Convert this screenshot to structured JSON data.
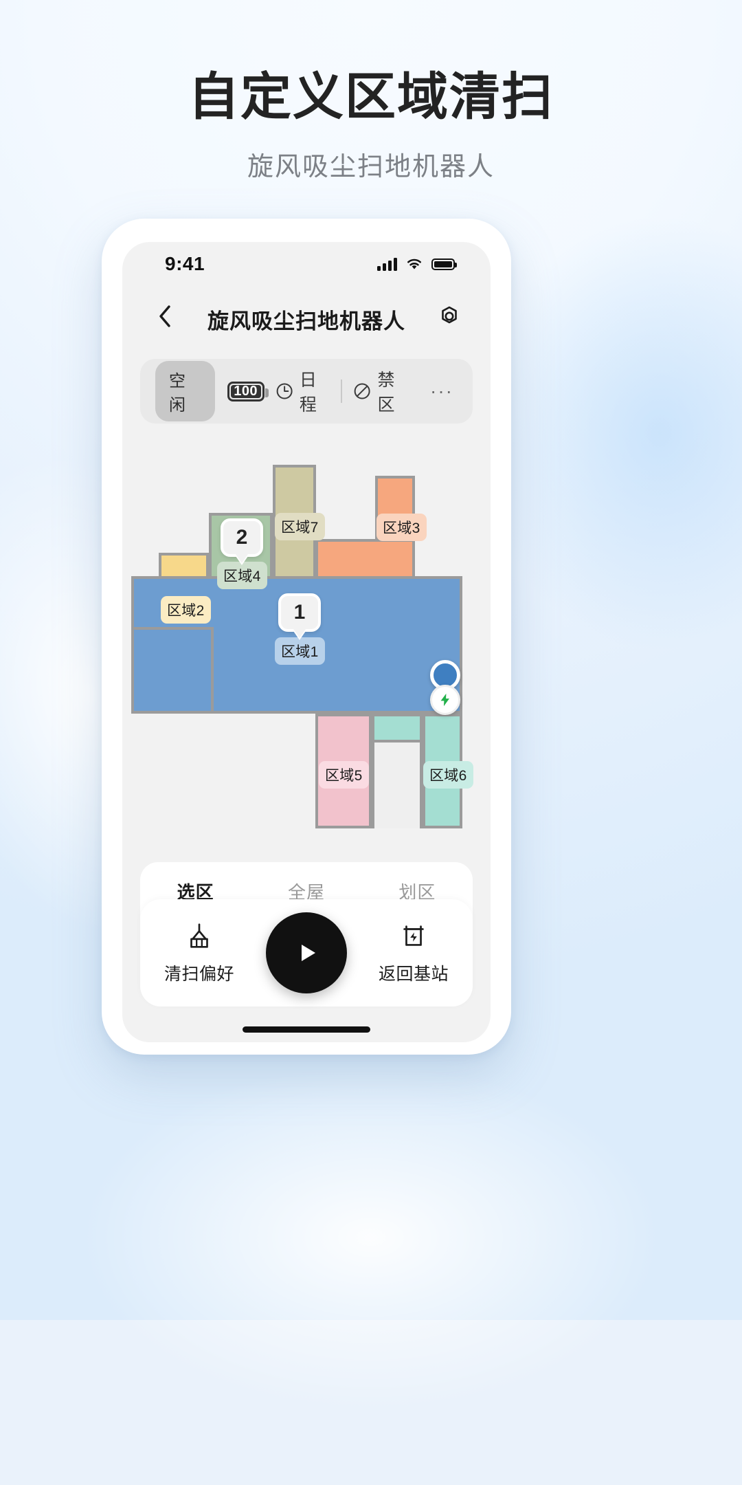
{
  "header": {
    "title": "自定义区域清扫",
    "subtitle": "旋风吸尘扫地机器人"
  },
  "phone": {
    "status_bar": {
      "time": "9:41",
      "signal_icon": "cellular-signal-icon",
      "wifi_icon": "wifi-icon",
      "battery_icon": "battery-icon"
    },
    "nav": {
      "back_icon": "chevron-left-icon",
      "title": "旋风吸尘扫地机器人",
      "settings_icon": "settings-gear-icon"
    },
    "toolbar": {
      "status_label": "空闲",
      "battery_percent": "100",
      "schedule_label": "日程",
      "schedule_icon": "clock-icon",
      "forbidden_label": "禁区",
      "forbidden_icon": "no-entry-icon",
      "more_label": "···"
    },
    "map": {
      "rooms": [
        {
          "name": "区域1",
          "color": "#6d9dd0",
          "order": "1"
        },
        {
          "name": "区域2",
          "color": "#f7d88a",
          "order": null
        },
        {
          "name": "区域3",
          "color": "#f6a77e",
          "order": null
        },
        {
          "name": "区域4",
          "color": "#a8c6a6",
          "order": "2"
        },
        {
          "name": "区域5",
          "color": "#f2c2cc",
          "order": null
        },
        {
          "name": "区域6",
          "color": "#a4ded2",
          "order": null
        },
        {
          "name": "区域7",
          "color": "#cec9a2",
          "order": null
        }
      ],
      "robot_icon": "robot-position-icon",
      "dock_icon": "charging-dock-icon"
    },
    "tabs": [
      {
        "label": "选区",
        "active": true
      },
      {
        "label": "全屋",
        "active": false
      },
      {
        "label": "划区",
        "active": false
      }
    ],
    "actions": {
      "left_label": "清扫偏好",
      "left_icon": "broom-icon",
      "play_icon": "play-icon",
      "right_label": "返回基站",
      "right_icon": "dock-return-icon"
    }
  },
  "colors": {
    "accent": "#2f7bf6",
    "page_bg": "#eaf2fb",
    "screen_bg": "#f2f2f2",
    "wall": "#9b9b9b"
  }
}
